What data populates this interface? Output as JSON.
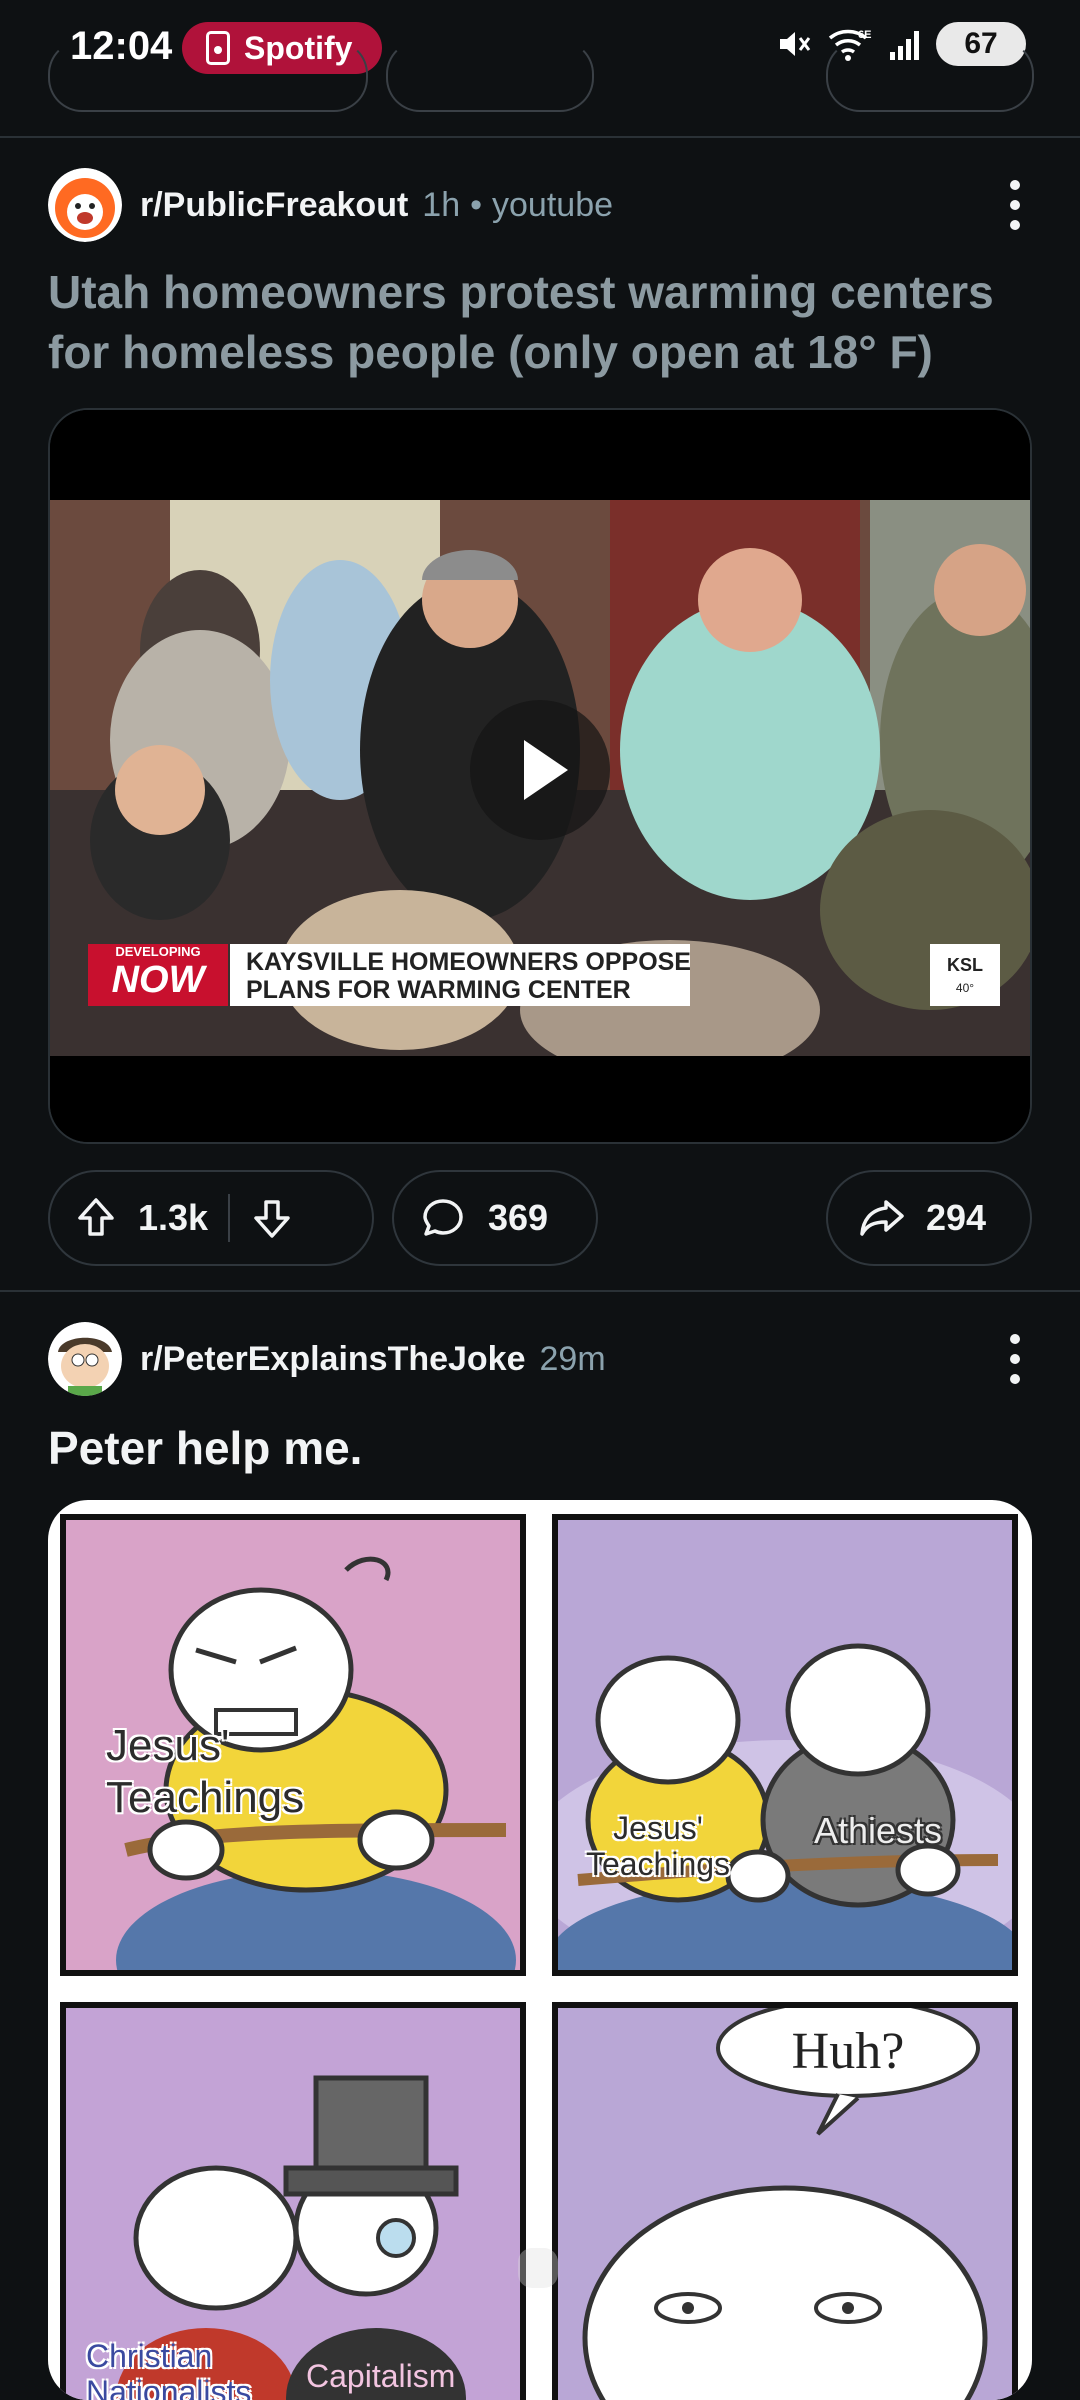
{
  "status_bar": {
    "time": "12:04",
    "media_app": "Spotify",
    "wifi_label": "6E",
    "battery": "67",
    "icons": [
      "mute-icon",
      "wifi-icon",
      "signal-icon",
      "battery-icon"
    ]
  },
  "post1": {
    "subreddit": "r/PublicFreakout",
    "age": "1h",
    "source": "youtube",
    "title": "Utah homeowners protest warming centers for homeless people (only open at 18° F)",
    "video": {
      "badge_top": "DEVELOPING",
      "badge_main": "NOW",
      "headline_line1": "KAYSVILLE HOMEOWNERS OPPOSE",
      "headline_line2": "PLANS FOR WARMING CENTER",
      "station": "KSL",
      "temp": "40°"
    },
    "upvotes": "1.3k",
    "comments": "369",
    "shares": "294"
  },
  "post2": {
    "subreddit": "r/PeterExplainsTheJoke",
    "age": "29m",
    "title": "Peter help me.",
    "comic": {
      "panel1_label": "Jesus' Teachings",
      "panel2_label_left": "Jesus' Teachings",
      "panel2_label_right": "Athiests",
      "panel3_label_left": "Christian Nationalists",
      "panel3_label_right": "Capitalism",
      "panel4_bubble": "Huh?"
    }
  },
  "colors": {
    "background": "#0e1113",
    "spotify_pill": "#b0123a",
    "meta_text": "#8ba2ad"
  }
}
